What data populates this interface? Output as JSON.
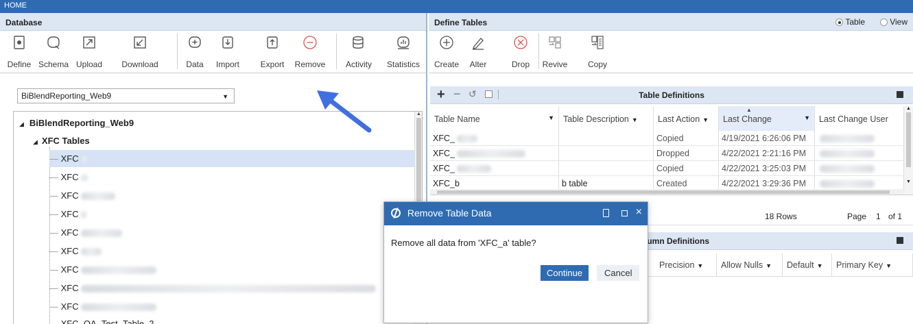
{
  "window": {
    "title": "HOME"
  },
  "database_panel": {
    "header": "Database",
    "toolbar": [
      {
        "label": "Define",
        "icon": "define-icon"
      },
      {
        "label": "Schema",
        "icon": "schema-icon"
      },
      {
        "label": "Upload",
        "icon": "upload-icon"
      },
      {
        "label": "Download",
        "icon": "download-icon"
      },
      {
        "label": "Data",
        "icon": "data-icon"
      },
      {
        "label": "Import",
        "icon": "import-icon"
      },
      {
        "label": "Export",
        "icon": "export-icon"
      },
      {
        "label": "Remove",
        "icon": "remove-icon"
      },
      {
        "label": "Activity",
        "icon": "activity-icon"
      },
      {
        "label": "Statistics",
        "icon": "statistics-icon"
      }
    ],
    "database_select": {
      "value": "BiBlendReporting_Web9"
    },
    "tree": {
      "root": "BiBlendReporting_Web9",
      "group": "XFC Tables",
      "items": [
        "XFC",
        "XFC",
        "XFC",
        "XFC",
        "XFC",
        "XFC",
        "XFC",
        "XFC",
        "XFC",
        "XFC",
        "XFC_QA_Test_Table_2"
      ]
    }
  },
  "define_panel": {
    "header": "Define Tables",
    "radio": {
      "table_label": "Table",
      "view_label": "View",
      "selected": "Table"
    },
    "toolbar": [
      {
        "label": "Create",
        "icon": "create-icon"
      },
      {
        "label": "Alter",
        "icon": "alter-icon"
      },
      {
        "label": "Drop",
        "icon": "drop-icon"
      },
      {
        "label": "Revive",
        "icon": "revive-icon"
      },
      {
        "label": "Copy",
        "icon": "copy-icon"
      }
    ],
    "table_definitions": {
      "title": "Table Definitions",
      "columns": [
        "Table Name",
        "Table Description",
        "Last Action",
        "Last Change",
        "Last Change User"
      ],
      "rows": [
        {
          "name": "XFC_",
          "description": "",
          "action": "Copied",
          "change": "4/19/2021 6:26:06 PM"
        },
        {
          "name": "XFC_",
          "description": "",
          "action": "Dropped",
          "change": "4/22/2021 2:21:16 PM"
        },
        {
          "name": "XFC_",
          "description": "",
          "action": "Copied",
          "change": "4/22/2021 3:25:03 PM"
        },
        {
          "name": "XFC_b",
          "description": "b table",
          "action": "Created",
          "change": "4/22/2021 3:29:36 PM"
        }
      ],
      "row_count": "18 Rows",
      "page_label": "Page",
      "page": "1",
      "of_label": "of 1"
    },
    "column_definitions": {
      "title": "Column Definitions",
      "columns": [
        "Precision",
        "Allow Nulls",
        "Default",
        "Primary Key"
      ]
    }
  },
  "dialog": {
    "title": "Remove Table Data",
    "message": "Remove all data from 'XFC_a' table?",
    "continue_label": "Continue",
    "cancel_label": "Cancel"
  },
  "colors": {
    "accent": "#2f6bb1",
    "header_bg": "#dde7f3",
    "selection": "#d6e2f5",
    "arrow": "#3f6fe0"
  }
}
